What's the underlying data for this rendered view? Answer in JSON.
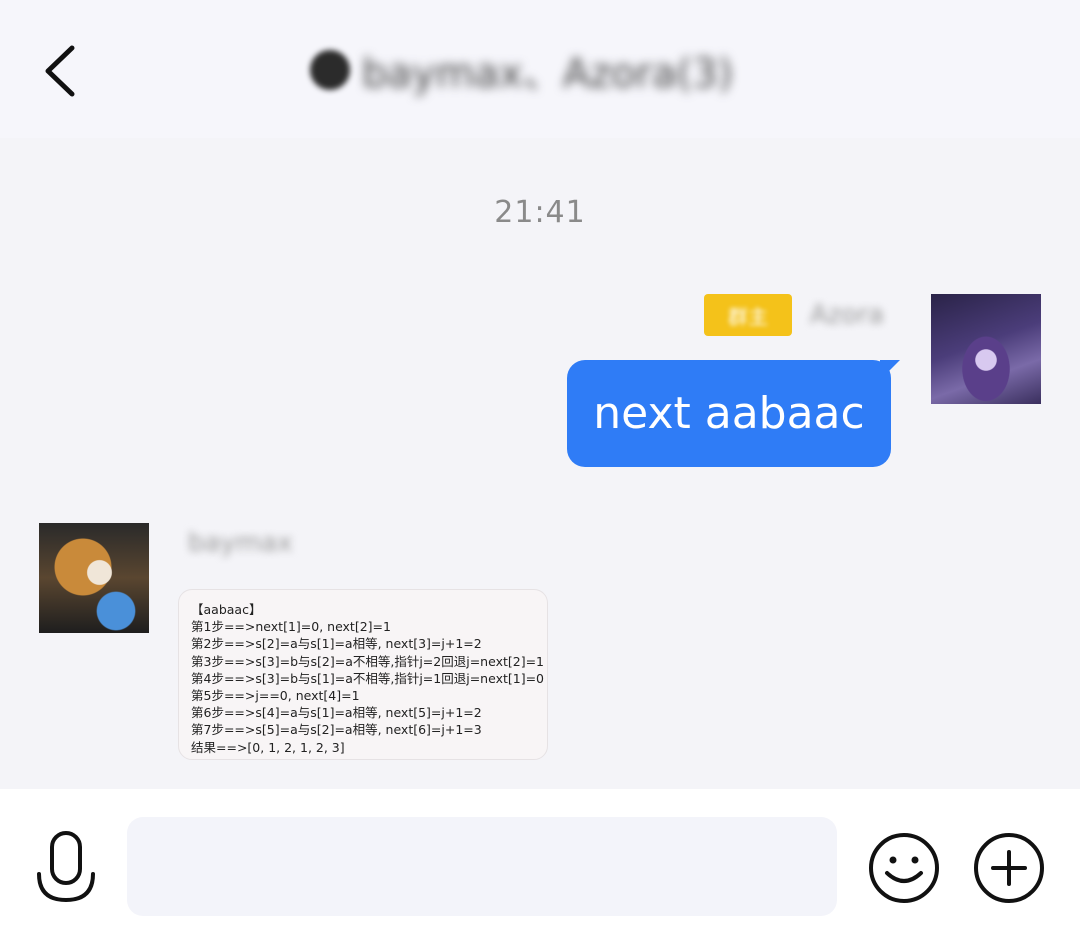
{
  "header": {
    "title": "baymax、Azora(3)",
    "back_icon": "chevron-left-icon"
  },
  "messages": {
    "timestamp": "21:41",
    "outgoing": {
      "badge": "群主",
      "sender_name": "Azora",
      "text": "next aabaac"
    },
    "incoming": {
      "sender_name": "baymax",
      "card_lines": [
        "【aabaac】",
        "第1步==>next[1]=0, next[2]=1",
        "第2步==>s[2]=a与s[1]=a相等, next[3]=j+1=2",
        "第3步==>s[3]=b与s[2]=a不相等,指针j=2回退j=next[2]=1",
        "第4步==>s[3]=b与s[1]=a不相等,指针j=1回退j=next[1]=0",
        "第5步==>j==0, next[4]=1",
        "第6步==>s[4]=a与s[1]=a相等, next[5]=j+1=2",
        "第7步==>s[5]=a与s[2]=a相等, next[6]=j+1=3",
        "结果==>[0, 1, 2, 1, 2, 3]"
      ]
    }
  },
  "input_bar": {
    "value": "",
    "icons": [
      "microphone-icon",
      "smiley-icon",
      "plus-icon"
    ]
  },
  "colors": {
    "bubble_out": "#2f7cf6",
    "badge": "#f4c21a",
    "background": "#f4f4f8"
  }
}
